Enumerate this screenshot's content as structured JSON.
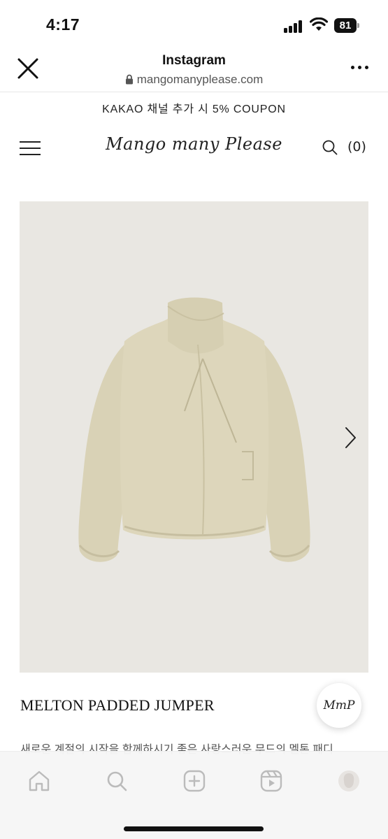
{
  "status_bar": {
    "time": "4:17",
    "battery": "81"
  },
  "browser": {
    "title": "Instagram",
    "url": "mangomanyplease.com",
    "icons": [
      "close-icon",
      "lock-icon",
      "more-icon"
    ]
  },
  "site": {
    "promo": "KAKAO 채널 추가 시 5% COUPON",
    "logo": "Mango many Please",
    "cart_count": "(0)",
    "icons": [
      "menu-icon",
      "search-icon"
    ]
  },
  "product": {
    "name": "MELTON PADDED JUMPER",
    "description": "새로운 계절의 시작을 함께하시기 좋은 사랑스러운 무드의 멜톤 패디",
    "image_icon": "next-arrow-icon",
    "chat_badge": "MmP"
  },
  "tab_bar": {
    "icons": [
      "home-icon",
      "search-icon",
      "create-icon",
      "reels-icon",
      "profile-icon"
    ]
  },
  "colors": {
    "image_background": "#e9e7e2",
    "jacket": "#ddd6bb",
    "tab_bar_background": "#f6f6f6"
  }
}
